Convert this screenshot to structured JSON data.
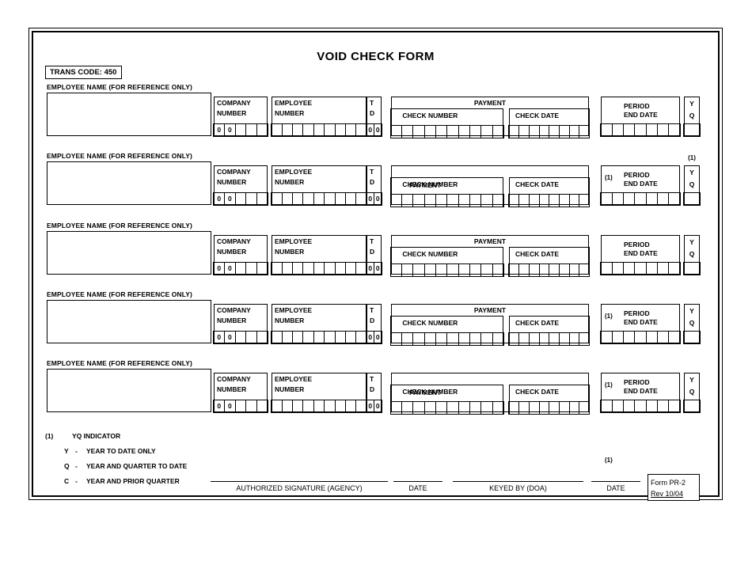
{
  "header": {
    "title": "VOID CHECK FORM",
    "trans_code": "TRANS CODE: 450"
  },
  "labels": {
    "employee_name": "EMPLOYEE NAME (FOR REFERENCE ONLY)",
    "company_number_line1": "COMPANY",
    "company_number_line2": "NUMBER",
    "employee_number_line1": "EMPLOYEE",
    "employee_number_line2": "NUMBER",
    "td_line1": "T",
    "td_line2": "D",
    "payment": "PAYMENT",
    "check_number": "CHECK  NUMBER",
    "check_date": "CHECK DATE",
    "period_end_line1": "PERIOD",
    "period_end_line2": "END DATE",
    "yq_y": "Y",
    "yq_q": "Q",
    "note_mark": "(1)"
  },
  "prefill": {
    "company_number": [
      "0",
      "0",
      "",
      "",
      ""
    ],
    "employee_number": [
      "",
      "",
      "",
      "",
      "",
      "",
      "",
      "",
      ""
    ],
    "td": [
      "0",
      "0"
    ],
    "check_number": [
      "",
      "",
      "",
      "",
      "",
      "",
      "",
      "",
      "",
      ""
    ],
    "check_date": [
      "",
      "",
      "",
      "",
      "",
      "",
      "",
      ""
    ],
    "period_end_date": [
      "",
      "",
      "",
      "",
      "",
      "",
      ""
    ],
    "yq": [
      ""
    ]
  },
  "rows": [
    {
      "index": 1,
      "period_note": false,
      "yq_note": false,
      "payment_overlaps_checknumber": false
    },
    {
      "index": 2,
      "period_note": true,
      "yq_note": true,
      "payment_overlaps_checknumber": true
    },
    {
      "index": 3,
      "period_note": false,
      "yq_note": false,
      "payment_overlaps_checknumber": false
    },
    {
      "index": 4,
      "period_note": true,
      "yq_note": false,
      "payment_overlaps_checknumber": false
    },
    {
      "index": 5,
      "period_note": true,
      "yq_note": false,
      "payment_overlaps_checknumber": true
    }
  ],
  "legend": {
    "title_mark": "(1)",
    "title": "YQ INDICATOR",
    "entries": [
      {
        "key": "Y",
        "dash": "-",
        "text": "YEAR TO DATE ONLY"
      },
      {
        "key": "Q",
        "dash": "-",
        "text": "YEAR AND QUARTER TO DATE"
      },
      {
        "key": "C",
        "dash": "-",
        "text": "YEAR AND PRIOR QUARTER"
      }
    ]
  },
  "footer": {
    "authorized_signature": "AUTHORIZED SIGNATURE (AGENCY)",
    "date_1": "DATE",
    "keyed_by": "KEYED BY (DOA)",
    "date_2": "DATE",
    "note_mark": "(1)",
    "form_id": "Form PR-2",
    "form_rev": "Rev 10/04"
  }
}
